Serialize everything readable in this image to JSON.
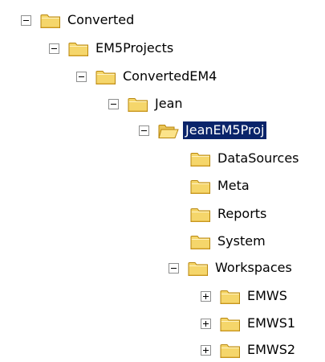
{
  "tree": {
    "nodes": [
      {
        "label": "Converted",
        "state": "expanded",
        "icon": "folder-closed-icon",
        "selected": false
      },
      {
        "label": "EM5Projects",
        "state": "expanded",
        "icon": "folder-closed-icon",
        "selected": false
      },
      {
        "label": "ConvertedEM4",
        "state": "expanded",
        "icon": "folder-closed-icon",
        "selected": false
      },
      {
        "label": "Jean",
        "state": "expanded",
        "icon": "folder-closed-icon",
        "selected": false
      },
      {
        "label": "JeanEM5Proj",
        "state": "expanded",
        "icon": "folder-open-icon",
        "selected": true
      },
      {
        "label": "DataSources",
        "state": "leaf",
        "icon": "folder-closed-icon",
        "selected": false
      },
      {
        "label": "Meta",
        "state": "leaf",
        "icon": "folder-closed-icon",
        "selected": false
      },
      {
        "label": "Reports",
        "state": "leaf",
        "icon": "folder-closed-icon",
        "selected": false
      },
      {
        "label": "System",
        "state": "leaf",
        "icon": "folder-closed-icon",
        "selected": false
      },
      {
        "label": "Workspaces",
        "state": "expanded",
        "icon": "folder-closed-icon",
        "selected": false
      },
      {
        "label": "EMWS",
        "state": "collapsed",
        "icon": "folder-closed-icon",
        "selected": false
      },
      {
        "label": "EMWS1",
        "state": "collapsed",
        "icon": "folder-closed-icon",
        "selected": false
      },
      {
        "label": "EMWS2",
        "state": "collapsed",
        "icon": "folder-closed-icon",
        "selected": false
      }
    ]
  },
  "colors": {
    "selection_bg": "#0a246a",
    "selection_text": "#ffffff",
    "folder_fill": "#f5d66b",
    "folder_outline": "#b8860b"
  }
}
